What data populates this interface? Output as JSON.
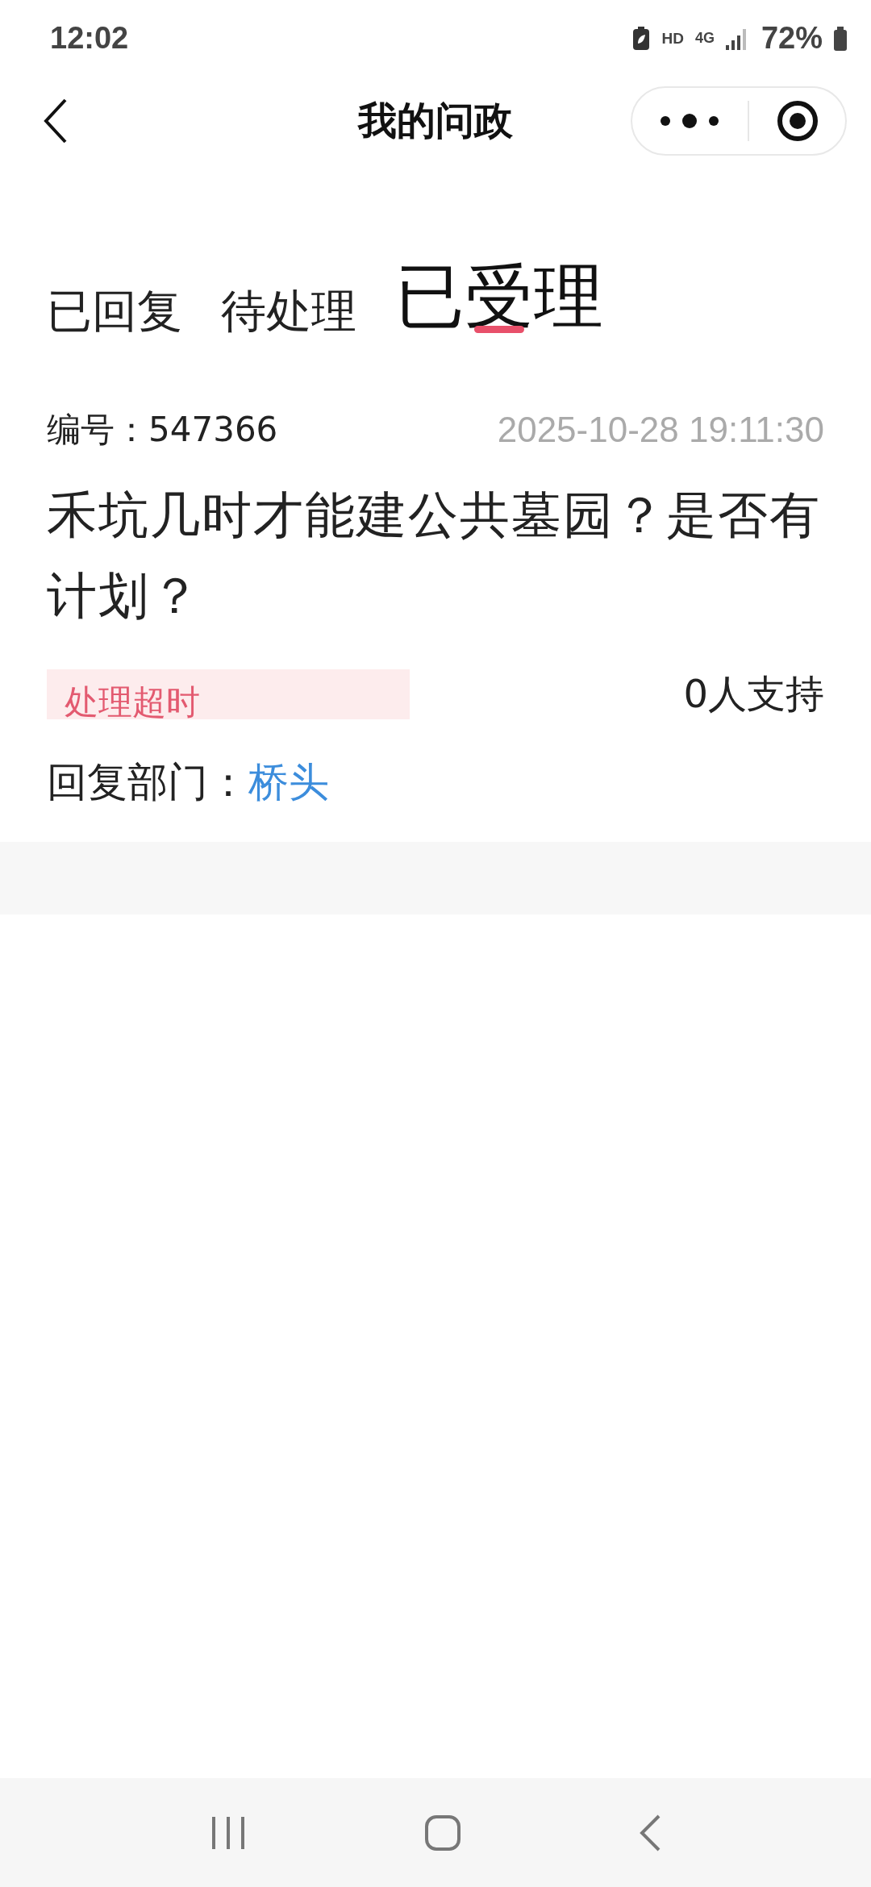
{
  "status_bar": {
    "time": "12:02",
    "hd": "HD",
    "network": "4G",
    "battery": "72%"
  },
  "nav": {
    "title": "我的问政"
  },
  "tabs": [
    {
      "label": "已回复",
      "selected": false
    },
    {
      "label": "待处理",
      "selected": false
    },
    {
      "label": "已受理",
      "selected": true
    }
  ],
  "record": {
    "number_label": "编号：",
    "number": "547366",
    "datetime": "2025-10-28 19:11:30",
    "title": "禾坑几时才能建公共墓园？是否有计划？",
    "status": "处理超时",
    "supporters": "0人支持",
    "department_label": "回复部门：",
    "department": "桥头"
  }
}
